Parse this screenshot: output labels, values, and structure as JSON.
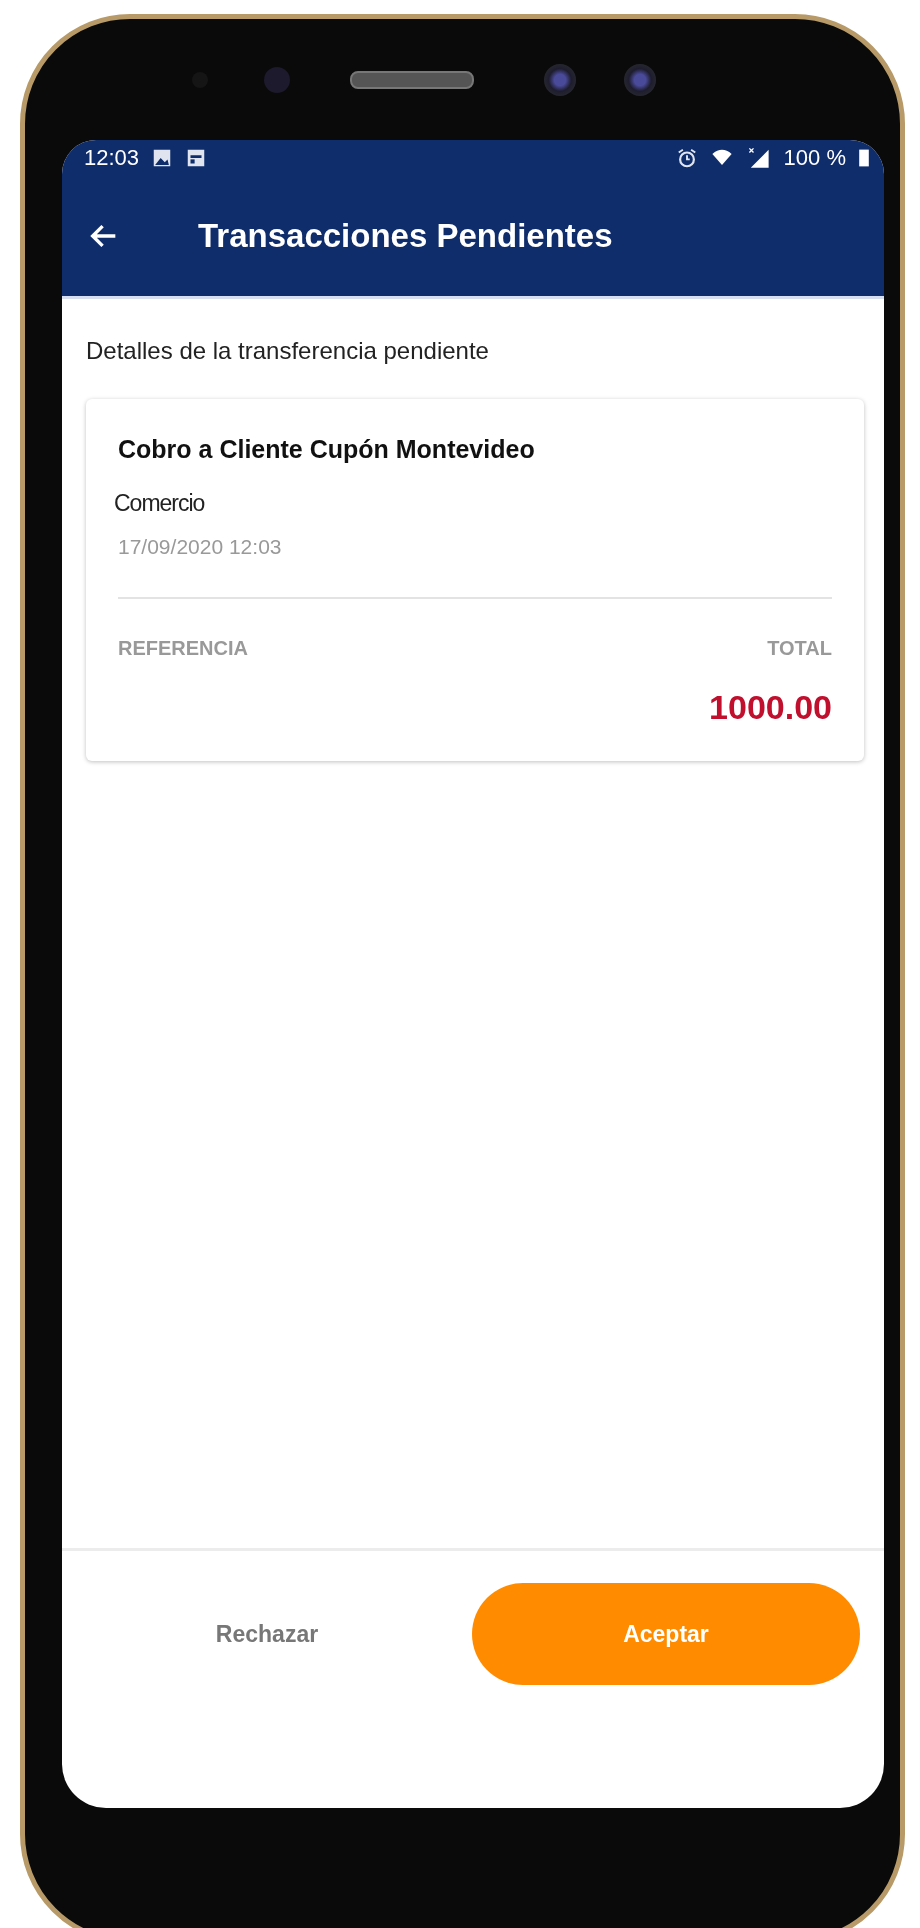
{
  "status_bar": {
    "time": "12:03",
    "battery": "100 %"
  },
  "app_bar": {
    "title": "Transacciones Pendientes"
  },
  "section_title": "Detalles de la transferencia pendiente",
  "card": {
    "title": "Cobro a Cliente Cupón Montevideo",
    "merchant": "Comercio",
    "date": "17/09/2020 12:03",
    "reference_label": "REFERENCIA",
    "total_label": "TOTAL",
    "total": "1000.00"
  },
  "buttons": [
    {
      "label": "Rechazar",
      "kind": "text"
    },
    {
      "label": "Aceptar",
      "kind": "primary"
    }
  ]
}
